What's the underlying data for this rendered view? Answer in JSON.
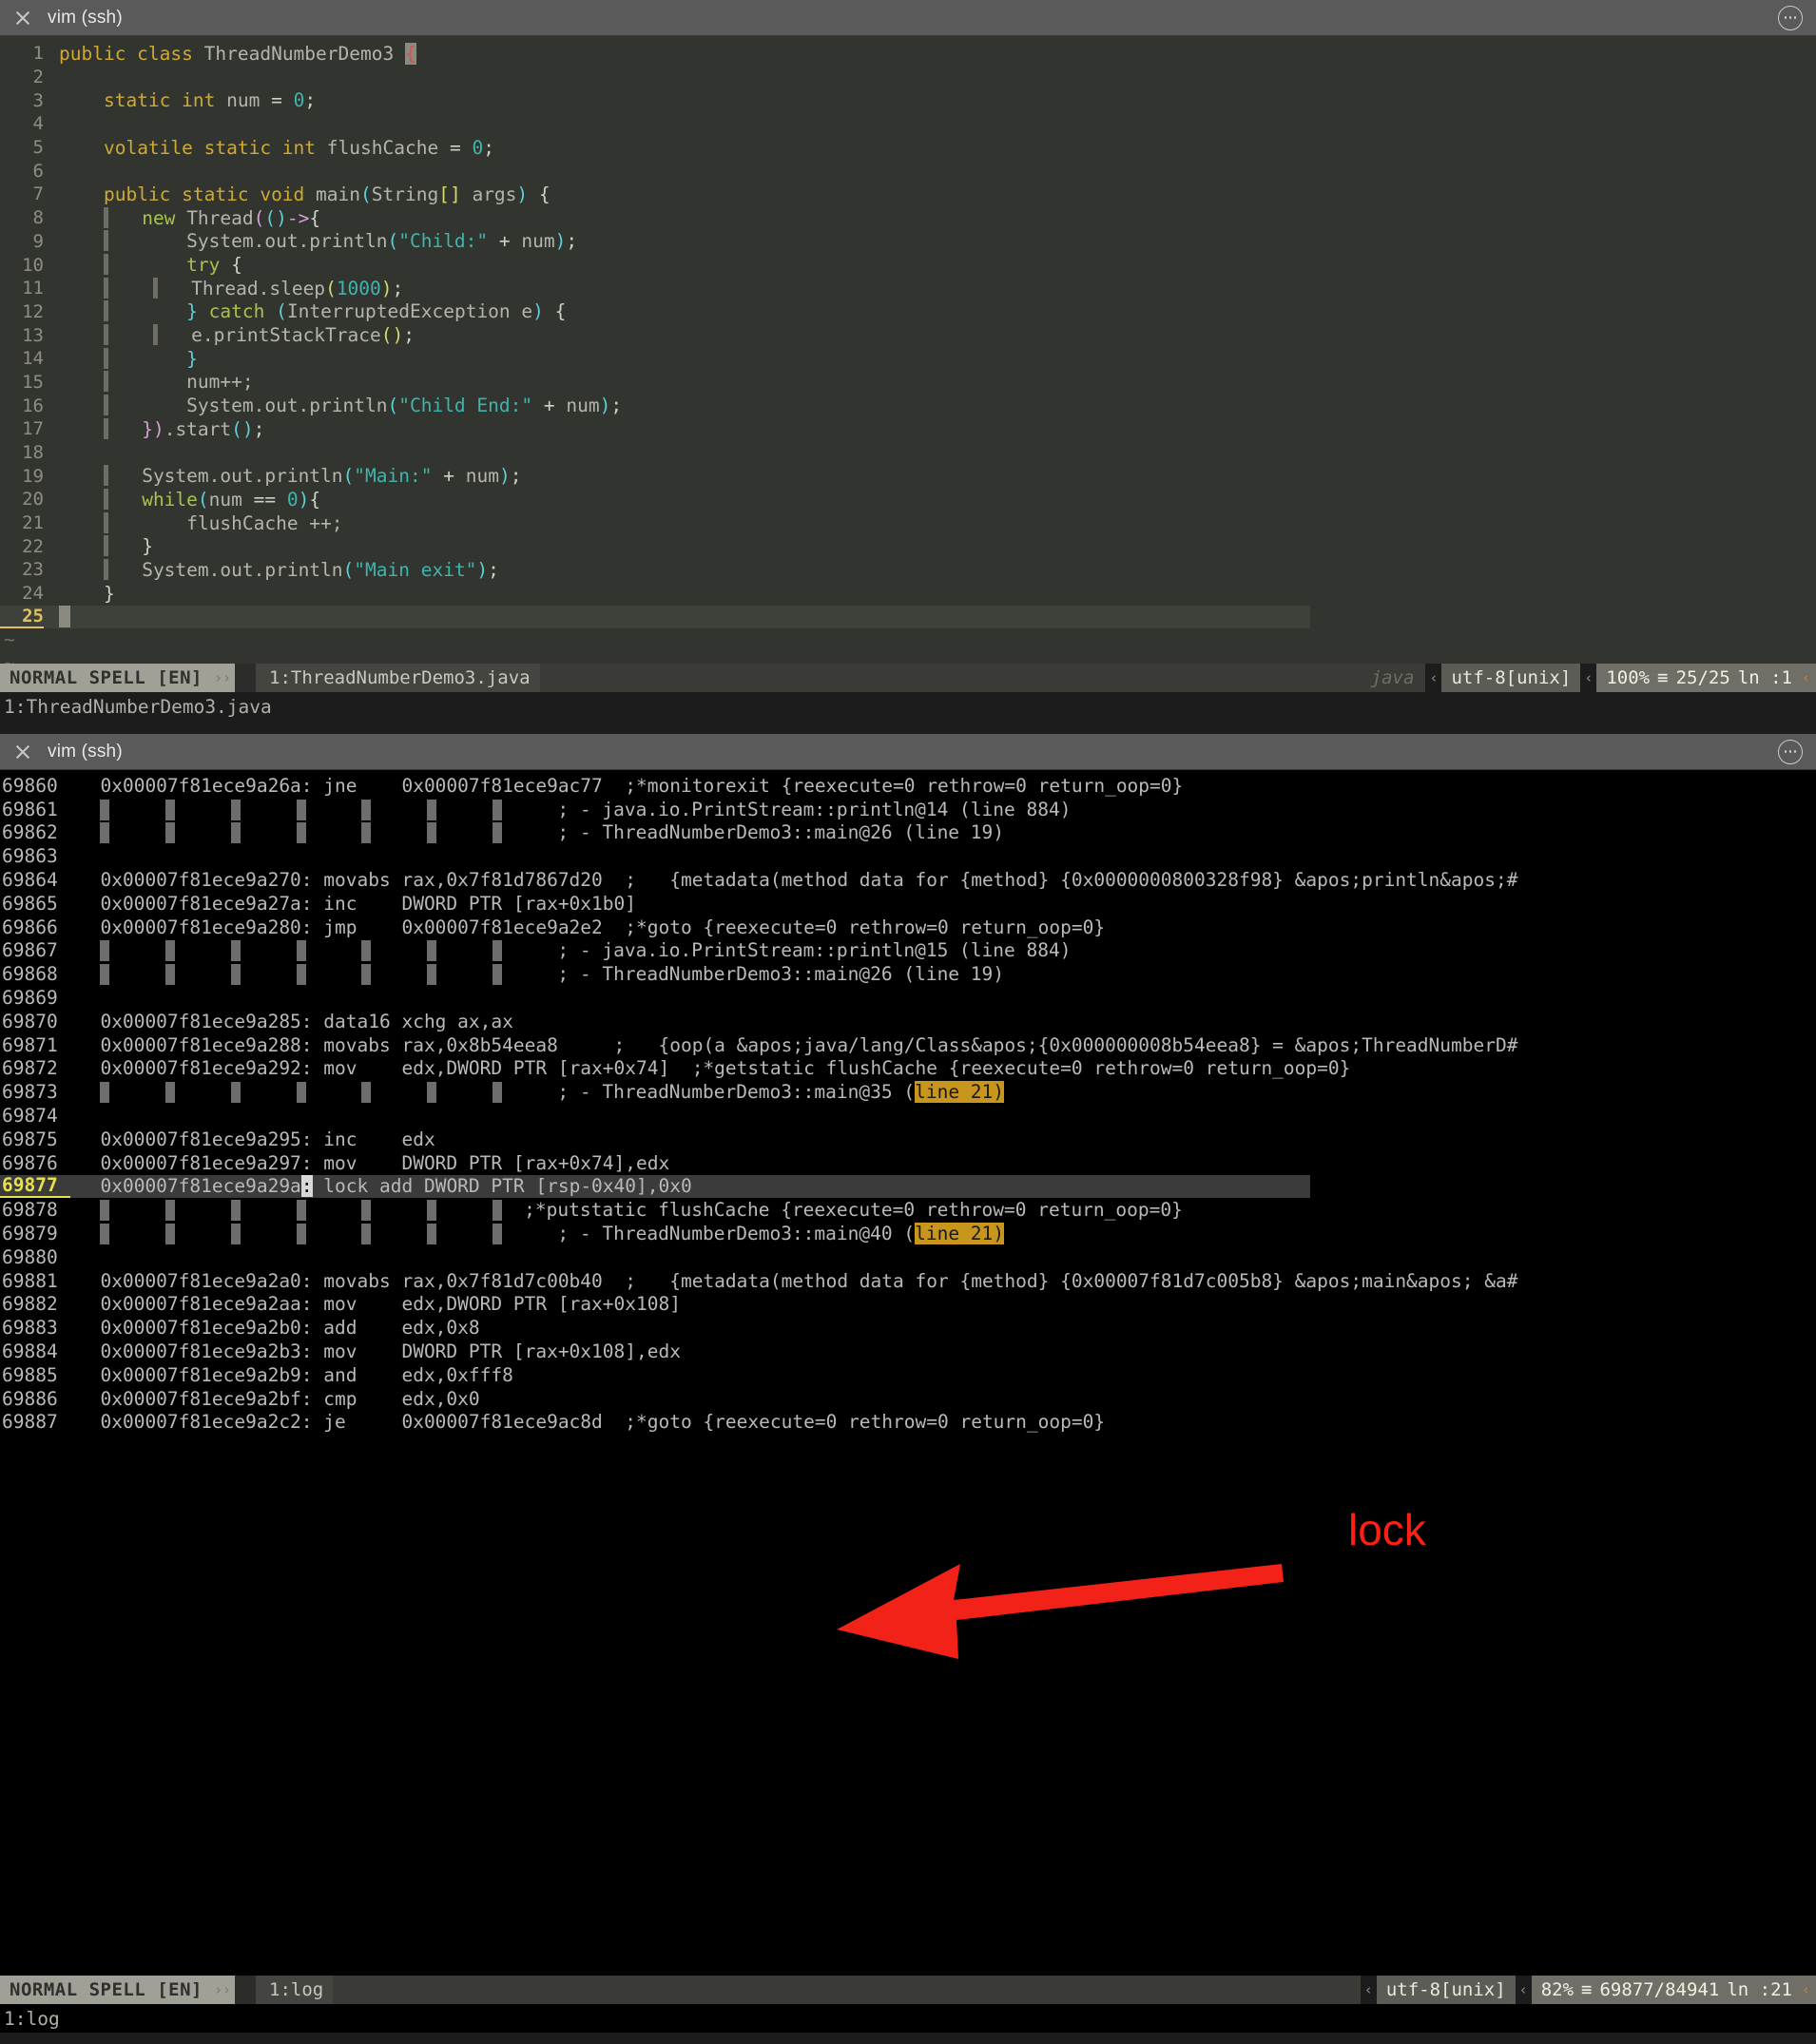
{
  "editor_pane": {
    "titlebar": {
      "title": "vim (ssh)",
      "close_icon": "close-icon",
      "menu_icon": "more-options-icon"
    },
    "lines": [
      {
        "n": "1",
        "html": "<span class='kw'>public class</span> <span class='pln'>ThreadNumberDemo3</span> <span class='cursorblk'>{</span>"
      },
      {
        "n": "2",
        "html": ""
      },
      {
        "n": "3",
        "html": "    <span class='kw'>static int</span> <span class='pln'>num</span> <span class='pun'>=</span> <span class='num'>0</span><span class='pun'>;</span>"
      },
      {
        "n": "4",
        "html": ""
      },
      {
        "n": "5",
        "html": "    <span class='kw'>volatile static int</span> <span class='pln'>flushCache</span> <span class='pun'>=</span> <span class='num'>0</span><span class='pun'>;</span>"
      },
      {
        "n": "6",
        "html": ""
      },
      {
        "n": "7",
        "html": "    <span class='kw'>public static void</span> <span class='pln'>main</span><span class='par'>(</span><span class='pln'>String</span><span class='brk'>[]</span> <span class='pln'>args</span><span class='par'>)</span> <span class='pun'>{</span>"
      },
      {
        "n": "8",
        "html": "    <span class='indent'></span>   <span class='kw2'>new</span> <span class='pln'>Thread</span><span class='par2'>(</span><span class='par'>()</span><span class='par2'>-&gt;</span><span class='pun'>{</span>"
      },
      {
        "n": "9",
        "html": "    <span class='indent'></span>       <span class='pln'>System.out.println</span><span class='par'>(</span><span class='str'>\"Child:\"</span> <span class='pun'>+</span> <span class='pln'>num</span><span class='par'>)</span><span class='pun'>;</span>"
      },
      {
        "n": "10",
        "html": "    <span class='indent'></span>       <span class='kw2'>try</span> <span class='pun'>{</span>"
      },
      {
        "n": "11",
        "html": "    <span class='indent'></span>    <span class='indent'></span>   <span class='pln'>Thread.sleep</span><span class='brk'>(</span><span class='num'>1000</span><span class='brk'>)</span><span class='pun'>;</span>"
      },
      {
        "n": "12",
        "html": "    <span class='indent'></span>       <span class='par'>}</span> <span class='kw2'>catch</span> <span class='par'>(</span><span class='pln'>InterruptedException e</span><span class='par'>)</span> <span class='pun'>{</span>"
      },
      {
        "n": "13",
        "html": "    <span class='indent'></span>    <span class='indent'></span>   <span class='pln'>e.printStackTrace</span><span class='brk'>()</span><span class='pun'>;</span>"
      },
      {
        "n": "14",
        "html": "    <span class='indent'></span>       <span class='par'>}</span>"
      },
      {
        "n": "15",
        "html": "    <span class='indent'></span>       <span class='pln'>num++;</span>"
      },
      {
        "n": "16",
        "html": "    <span class='indent'></span>       <span class='pln'>System.out.println</span><span class='par'>(</span><span class='str'>\"Child End:\"</span> <span class='pun'>+</span> <span class='pln'>num</span><span class='par'>)</span><span class='pun'>;</span>"
      },
      {
        "n": "17",
        "html": "    <span class='indent'></span>   <span class='par2'>}</span><span class='par2'>)</span><span class='pln'>.start</span><span class='par'>()</span><span class='pun'>;</span>"
      },
      {
        "n": "18",
        "html": ""
      },
      {
        "n": "19",
        "html": "    <span class='indent'></span>   <span class='pln'>System.out.println</span><span class='par'>(</span><span class='str'>\"Main:\"</span> <span class='pun'>+</span> <span class='pln'>num</span><span class='par'>)</span><span class='pun'>;</span>"
      },
      {
        "n": "20",
        "html": "    <span class='indent'></span>   <span class='kw2'>while</span><span class='par'>(</span><span class='pln'>num</span> <span class='pun'>==</span> <span class='num'>0</span><span class='par'>)</span><span class='pun'>{</span>"
      },
      {
        "n": "21",
        "html": "    <span class='indent'></span>       <span class='pln'>flushCache ++;</span>"
      },
      {
        "n": "22",
        "html": "    <span class='indent'></span>   <span class='pun'>}</span>"
      },
      {
        "n": "23",
        "html": "    <span class='indent'></span>   <span class='pln'>System.out.println</span><span class='par'>(</span><span class='str'>\"Main exit\"</span><span class='par'>)</span><span class='pun'>;</span>"
      },
      {
        "n": "24",
        "html": "    <span class='pun'>}</span>"
      },
      {
        "n": "25",
        "html": "<span class='cursorblk'> </span>",
        "current": true
      }
    ],
    "filler_rows": [
      "~",
      "~"
    ],
    "statusline": {
      "mode": "NORMAL  SPELL [EN]",
      "sep": "››",
      "file": "1:ThreadNumberDemo3.java",
      "filetype": "java",
      "encoding": "utf-8[unix]",
      "percent": "100%",
      "ruler_glyph": "≡",
      "position": "25/25",
      "column": "ln :1",
      "chev": "‹"
    },
    "command_line": "1:ThreadNumberDemo3.java"
  },
  "log_pane": {
    "titlebar": {
      "title": "vim (ssh)",
      "close_icon": "close-icon",
      "menu_icon": "more-options-icon"
    },
    "lines": [
      {
        "n": "69860",
        "html": "  0x00007f81ece9a26a: jne    0x00007f81ece9ac77  ;*monitorexit {reexecute=0 rethrow=0 return_oop=0}"
      },
      {
        "n": "69861",
        "html": "  <span class='iblk'></span>     <span class='iblk'></span>     <span class='iblk'></span>     <span class='iblk'></span>     <span class='iblk'></span>     <span class='iblk'></span>     <span class='iblk'></span>     ; - java.io.PrintStream::println@14 (line 884)"
      },
      {
        "n": "69862",
        "html": "  <span class='iblk'></span>     <span class='iblk'></span>     <span class='iblk'></span>     <span class='iblk'></span>     <span class='iblk'></span>     <span class='iblk'></span>     <span class='iblk'></span>     ; - ThreadNumberDemo3::main@26 (line 19)"
      },
      {
        "n": "69863",
        "html": ""
      },
      {
        "n": "69864",
        "html": "  0x00007f81ece9a270: movabs rax,0x7f81d7867d20  ;   {metadata(method data for {method} {0x0000000800328f98} &amp;apos;println&amp;apos;#"
      },
      {
        "n": "69865",
        "html": "  0x00007f81ece9a27a: inc    DWORD PTR [rax+0x1b0]"
      },
      {
        "n": "69866",
        "html": "  0x00007f81ece9a280: jmp    0x00007f81ece9a2e2  ;*goto {reexecute=0 rethrow=0 return_oop=0}"
      },
      {
        "n": "69867",
        "html": "  <span class='iblk'></span>     <span class='iblk'></span>     <span class='iblk'></span>     <span class='iblk'></span>     <span class='iblk'></span>     <span class='iblk'></span>     <span class='iblk'></span>     ; - java.io.PrintStream::println@15 (line 884)"
      },
      {
        "n": "69868",
        "html": "  <span class='iblk'></span>     <span class='iblk'></span>     <span class='iblk'></span>     <span class='iblk'></span>     <span class='iblk'></span>     <span class='iblk'></span>     <span class='iblk'></span>     ; - ThreadNumberDemo3::main@26 (line 19)"
      },
      {
        "n": "69869",
        "html": ""
      },
      {
        "n": "69870",
        "html": "  0x00007f81ece9a285: data16 xchg ax,ax"
      },
      {
        "n": "69871",
        "html": "  0x00007f81ece9a288: movabs rax,0x8b54eea8     ;   {oop(a &amp;apos;java/lang/Class&amp;apos;{0x000000008b54eea8} = &amp;apos;ThreadNumberD#"
      },
      {
        "n": "69872",
        "html": "  0x00007f81ece9a292: mov    edx,DWORD PTR [rax+0x74]  ;*getstatic flushCache {reexecute=0 rethrow=0 return_oop=0}"
      },
      {
        "n": "69873",
        "html": "  <span class='iblk'></span>     <span class='iblk'></span>     <span class='iblk'></span>     <span class='iblk'></span>     <span class='iblk'></span>     <span class='iblk'></span>     <span class='iblk'></span>     ; - ThreadNumberDemo3::main@35 (<span class='hl-line'>line 21)</span>"
      },
      {
        "n": "69874",
        "html": ""
      },
      {
        "n": "69875",
        "html": "  0x00007f81ece9a295: inc    edx"
      },
      {
        "n": "69876",
        "html": "  0x00007f81ece9a297: mov    DWORD PTR [rax+0x74],edx"
      },
      {
        "n": "69877",
        "html": "  0x00007f81ece9a29a<span class='curchar'>:</span> lock add DWORD PTR [rsp-0x40],0x0",
        "current": true
      },
      {
        "n": "69878",
        "html": "  <span class='iblk'></span>     <span class='iblk'></span>     <span class='iblk'></span>     <span class='iblk'></span>     <span class='iblk'></span>     <span class='iblk'></span>     <span class='iblk'></span>  ;*putstatic flushCache {reexecute=0 rethrow=0 return_oop=0}"
      },
      {
        "n": "69879",
        "html": "  <span class='iblk'></span>     <span class='iblk'></span>     <span class='iblk'></span>     <span class='iblk'></span>     <span class='iblk'></span>     <span class='iblk'></span>     <span class='iblk'></span>     ; - ThreadNumberDemo3::main@40 (<span class='hl-line'>line 21)</span>"
      },
      {
        "n": "69880",
        "html": ""
      },
      {
        "n": "69881",
        "html": "  0x00007f81ece9a2a0: movabs rax,0x7f81d7c00b40  ;   {metadata(method data for {method} {0x00007f81d7c005b8} &amp;apos;main&amp;apos; &amp;a#"
      },
      {
        "n": "69882",
        "html": "  0x00007f81ece9a2aa: mov    edx,DWORD PTR [rax+0x108]"
      },
      {
        "n": "69883",
        "html": "  0x00007f81ece9a2b0: add    edx,0x8"
      },
      {
        "n": "69884",
        "html": "  0x00007f81ece9a2b3: mov    DWORD PTR [rax+0x108],edx"
      },
      {
        "n": "69885",
        "html": "  0x00007f81ece9a2b9: and    edx,0xfff8"
      },
      {
        "n": "69886",
        "html": "  0x00007f81ece9a2bf: cmp    edx,0x0"
      },
      {
        "n": "69887",
        "html": "  0x00007f81ece9a2c2: je     0x00007f81ece9ac8d  ;*goto {reexecute=0 rethrow=0 return_oop=0}"
      }
    ],
    "statusline": {
      "mode": "NORMAL  SPELL [EN]",
      "sep": "››",
      "file": "1:log",
      "filetype": "",
      "encoding": "utf-8[unix]",
      "percent": "82%",
      "ruler_glyph": "≡",
      "position": "69877/84941",
      "column": "ln :21",
      "chev": "‹"
    },
    "command_line": "1:log"
  },
  "annotation": {
    "label": "lock",
    "color": "#ff1f13",
    "arrow": "left-pointing-arrow"
  }
}
